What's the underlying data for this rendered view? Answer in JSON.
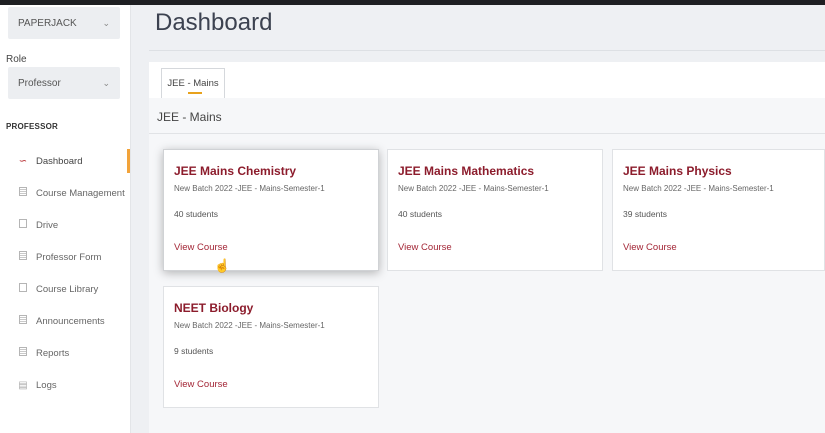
{
  "sidebar": {
    "institution_select": "PAPERJACK",
    "role_label": "Role",
    "role_select": "Professor",
    "section_heading": "PROFESSOR",
    "items": [
      {
        "label": "Dashboard",
        "icon": "trend-line-icon"
      },
      {
        "label": "Course Management",
        "icon": "document-icon"
      },
      {
        "label": "Drive",
        "icon": "folder-icon"
      },
      {
        "label": "Professor Form",
        "icon": "form-icon"
      },
      {
        "label": "Course Library",
        "icon": "library-icon"
      },
      {
        "label": "Announcements",
        "icon": "announcement-icon"
      },
      {
        "label": "Reports",
        "icon": "report-icon"
      },
      {
        "label": "Logs",
        "icon": "log-icon"
      }
    ]
  },
  "main": {
    "title": "Dashboard",
    "tab": "JEE - Mains",
    "section_title": "JEE - Mains",
    "cards": [
      {
        "title": "JEE Mains Chemistry",
        "batch": "New Batch 2022 -JEE - Mains-Semester-1",
        "students": "40 students",
        "link": "View Course"
      },
      {
        "title": "JEE Mains Mathematics",
        "batch": "New Batch 2022 -JEE - Mains-Semester-1",
        "students": "40 students",
        "link": "View Course"
      },
      {
        "title": "JEE Mains Physics",
        "batch": "New Batch 2022 -JEE - Mains-Semester-1",
        "students": "39 students",
        "link": "View Course"
      },
      {
        "title": "NEET Biology",
        "batch": "New Batch 2022 -JEE - Mains-Semester-1",
        "students": "9 students",
        "link": "View Course"
      }
    ]
  },
  "colors": {
    "accent": "#8c1c2c",
    "active_indicator": "#f2a33a",
    "tab_underline": "#e8a21c"
  }
}
